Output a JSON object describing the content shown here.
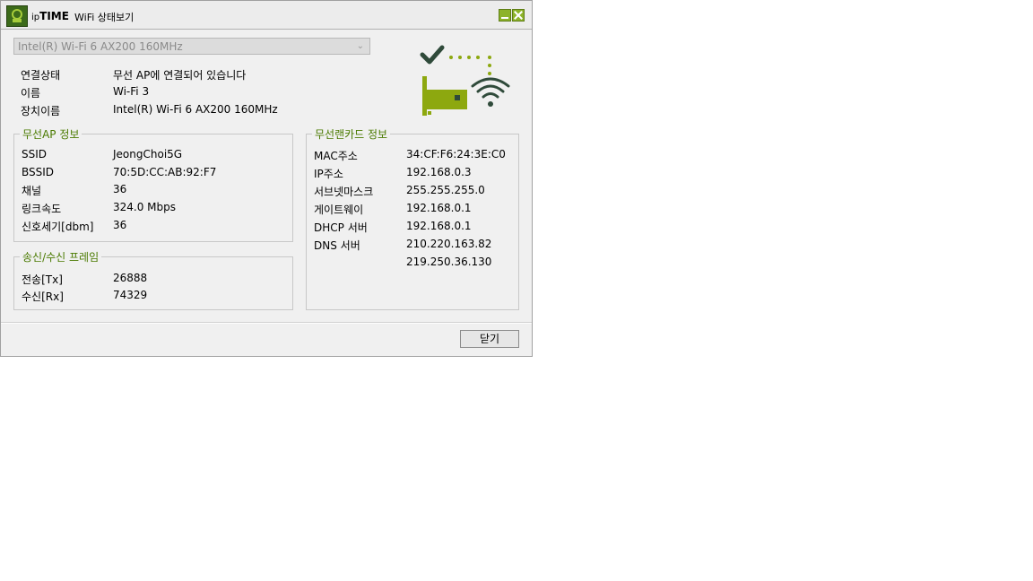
{
  "titlebar": {
    "brand_prefix": "ip",
    "brand_name": "TIME",
    "title": "WiFi 상태보기"
  },
  "adapter_select": {
    "value": "Intel(R) Wi-Fi 6 AX200 160MHz"
  },
  "status": [
    {
      "label": "연결상태",
      "value": "무선 AP에 연결되어 있습니다"
    },
    {
      "label": "이름",
      "value": "Wi-Fi 3"
    },
    {
      "label": "장치이름",
      "value": "Intel(R) Wi-Fi 6 AX200 160MHz"
    }
  ],
  "ap_info": {
    "title": "무선AP 정보",
    "rows": [
      {
        "label": "SSID",
        "value": "JeongChoi5G"
      },
      {
        "label": "BSSID",
        "value": "70:5D:CC:AB:92:F7"
      },
      {
        "label": "채널",
        "value": "36"
      },
      {
        "label": "링크속도",
        "value": "324.0 Mbps"
      },
      {
        "label": "신호세기[dbm]",
        "value": "36"
      }
    ]
  },
  "frames": {
    "title": "송신/수신 프레임",
    "rows": [
      {
        "label": "전송[Tx]",
        "value": "26888"
      },
      {
        "label": "수신[Rx]",
        "value": "74329"
      }
    ]
  },
  "card_info": {
    "title": "무선랜카드 정보",
    "rows": [
      {
        "label": "MAC주소",
        "value": "34:CF:F6:24:3E:C0"
      },
      {
        "label": "IP주소",
        "value": "192.168.0.3"
      },
      {
        "label": "서브넷마스크",
        "value": "255.255.255.0"
      },
      {
        "label": "게이트웨이",
        "value": "192.168.0.1"
      },
      {
        "label": "DHCP 서버",
        "value": "192.168.0.1"
      },
      {
        "label": "DNS 서버",
        "value": "210.220.163.82"
      },
      {
        "label": "",
        "value": "219.250.36.130"
      }
    ]
  },
  "buttons": {
    "close": "닫기"
  },
  "colors": {
    "accent": "#4a7a00",
    "graphic_green": "#8da80f",
    "graphic_dark": "#2f4a3a"
  },
  "icons": [
    "app-logo-icon",
    "minimize-icon",
    "close-icon",
    "chevron-down-icon",
    "checkmark-icon",
    "network-card-icon",
    "wifi-signal-icon"
  ]
}
